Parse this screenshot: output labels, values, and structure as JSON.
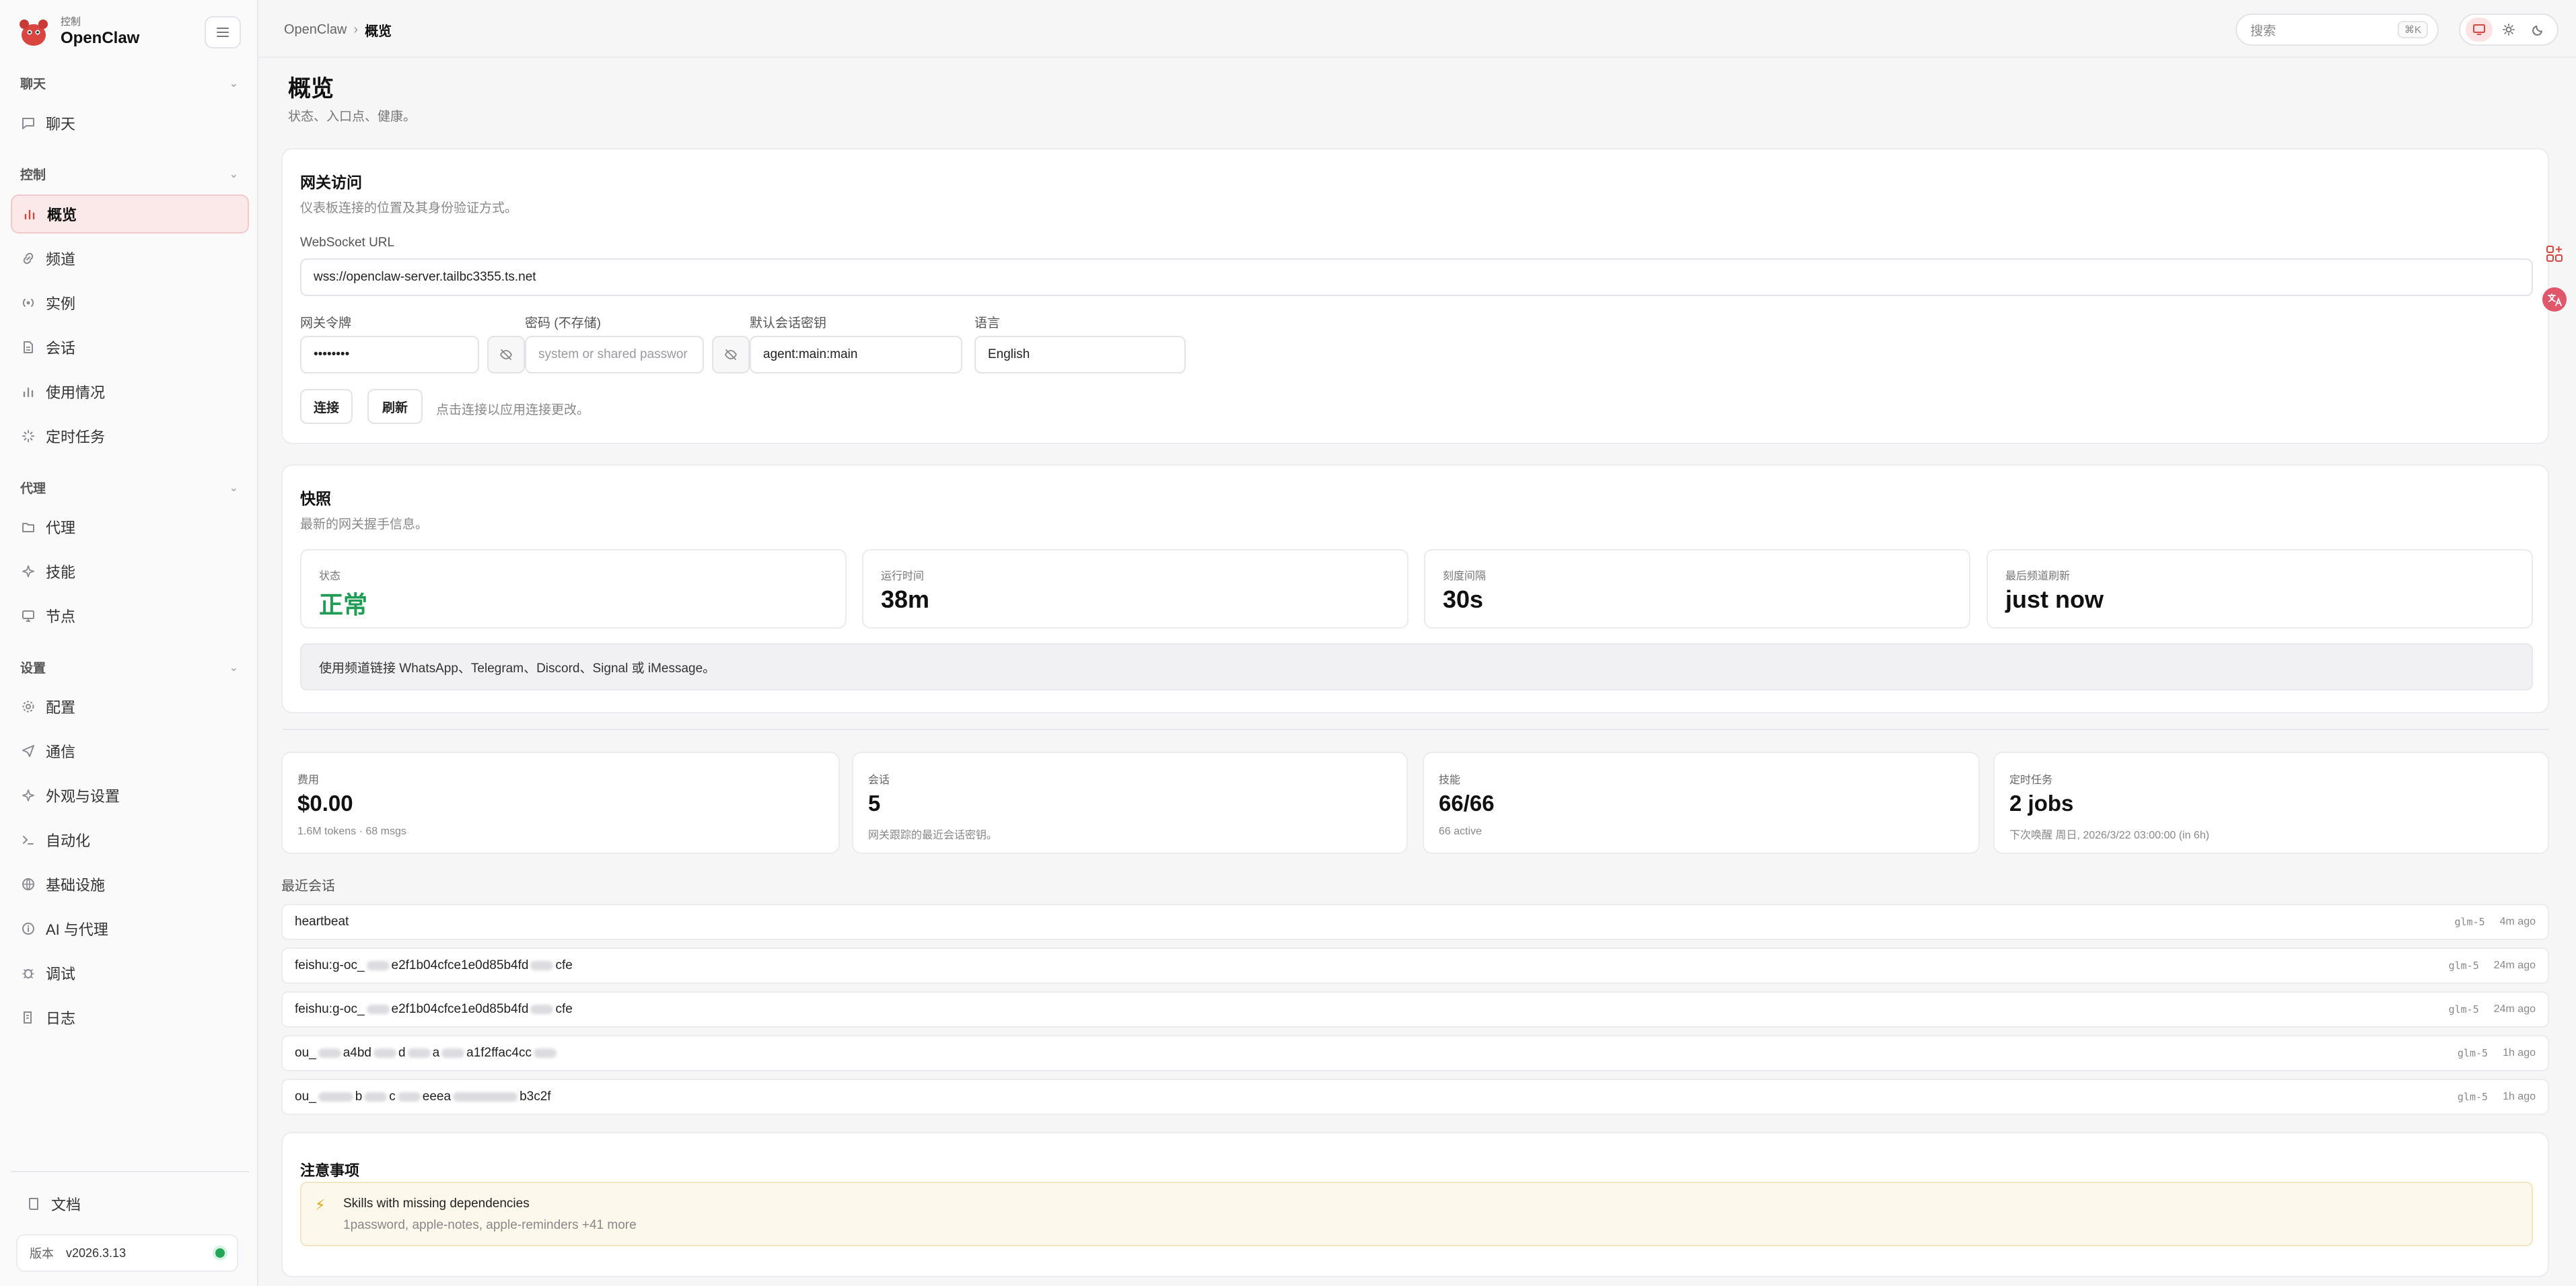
{
  "brand": {
    "sub": "控制",
    "name": "OpenClaw"
  },
  "sidebar": {
    "groups": [
      {
        "title": "聊天",
        "items": [
          {
            "label": "聊天",
            "icon": "chat-icon"
          }
        ]
      },
      {
        "title": "控制",
        "items": [
          {
            "label": "概览",
            "icon": "bar-chart-icon",
            "active": true
          },
          {
            "label": "频道",
            "icon": "link-icon"
          },
          {
            "label": "实例",
            "icon": "radio-icon"
          },
          {
            "label": "会话",
            "icon": "document-icon"
          },
          {
            "label": "使用情况",
            "icon": "bar-chart-icon"
          },
          {
            "label": "定时任务",
            "icon": "loader-icon"
          }
        ]
      },
      {
        "title": "代理",
        "items": [
          {
            "label": "代理",
            "icon": "folder-icon"
          },
          {
            "label": "技能",
            "icon": "sparkle-icon"
          },
          {
            "label": "节点",
            "icon": "monitor-icon"
          }
        ]
      },
      {
        "title": "设置",
        "items": [
          {
            "label": "配置",
            "icon": "gear-icon"
          },
          {
            "label": "通信",
            "icon": "send-icon"
          },
          {
            "label": "外观与设置",
            "icon": "sparkle-icon"
          },
          {
            "label": "自动化",
            "icon": "terminal-icon"
          },
          {
            "label": "基础设施",
            "icon": "globe-icon"
          },
          {
            "label": "AI 与代理",
            "icon": "info-icon"
          },
          {
            "label": "调试",
            "icon": "bug-icon"
          },
          {
            "label": "日志",
            "icon": "scroll-icon"
          }
        ]
      }
    ],
    "docs_label": "文档",
    "version_label": "版本",
    "version_value": "v2026.3.13"
  },
  "topbar": {
    "crumb_root": "OpenClaw",
    "crumb_sep": "›",
    "crumb_current": "概览",
    "search_placeholder": "搜索",
    "search_shortcut": "⌘K"
  },
  "page": {
    "title": "概览",
    "subtitle": "状态、入口点、健康。"
  },
  "gateway": {
    "title": "网关访问",
    "desc": "仪表板连接的位置及其身份验证方式。",
    "ws_label": "WebSocket URL",
    "ws_value": "wss://openclaw-server.tailbc3355.ts.net",
    "token_label": "网关令牌",
    "token_value": "••••••••",
    "password_label": "密码 (不存储)",
    "password_placeholder": "system or shared passwor",
    "session_key_label": "默认会话密钥",
    "session_key_value": "agent:main:main",
    "language_label": "语言",
    "language_value": "English",
    "connect_label": "连接",
    "refresh_label": "刷新",
    "hint": "点击连接以应用连接更改。"
  },
  "snapshot": {
    "title": "快照",
    "desc": "最新的网关握手信息。",
    "stats": [
      {
        "label": "状态",
        "value": "正常",
        "ok": true
      },
      {
        "label": "运行时间",
        "value": "38m"
      },
      {
        "label": "刻度间隔",
        "value": "30s"
      },
      {
        "label": "最后频道刷新",
        "value": "just now"
      }
    ],
    "note": "使用频道链接 WhatsApp、Telegram、Discord、Signal 或 iMessage。"
  },
  "metrics": [
    {
      "label": "费用",
      "value": "$0.00",
      "sub": "1.6M tokens · 68 msgs"
    },
    {
      "label": "会话",
      "value": "5",
      "sub": "网关跟踪的最近会话密钥。"
    },
    {
      "label": "技能",
      "value": "66/66",
      "sub": "66 active"
    },
    {
      "label": "定时任务",
      "value": "2 jobs",
      "sub": "下次唤醒 周日, 2026/3/22 03:00:00 (in 6h)"
    }
  ],
  "recent": {
    "title": "最近会话",
    "sessions": [
      {
        "parts": [
          "heartbeat"
        ],
        "model": "glm-5",
        "time": "4m ago"
      },
      {
        "parts": [
          "feishu:g-oc_",
          "e2f1b04cfce1e0d85b4fd",
          "cfe"
        ],
        "model": "glm-5",
        "time": "24m ago"
      },
      {
        "parts": [
          "feishu:g-oc_",
          "e2f1b04cfce1e0d85b4fd",
          "cfe"
        ],
        "model": "glm-5",
        "time": "24m ago"
      },
      {
        "parts": [
          "ou_",
          "a4bd",
          "d",
          "a",
          "a1f2ffac4cc"
        ],
        "model": "glm-5",
        "time": "1h ago"
      },
      {
        "parts": [
          "ou_",
          "b",
          "c",
          "eeea",
          "b3c2f"
        ],
        "model": "glm-5",
        "time": "1h ago"
      }
    ]
  },
  "attention": {
    "title": "注意事项",
    "warn_title": "Skills with missing dependencies",
    "warn_sub": "1password, apple-notes, apple-reminders +41 more"
  },
  "colors": {
    "accent": "#d9453f",
    "ok": "#1f9d55",
    "warn": "#e6a817"
  }
}
